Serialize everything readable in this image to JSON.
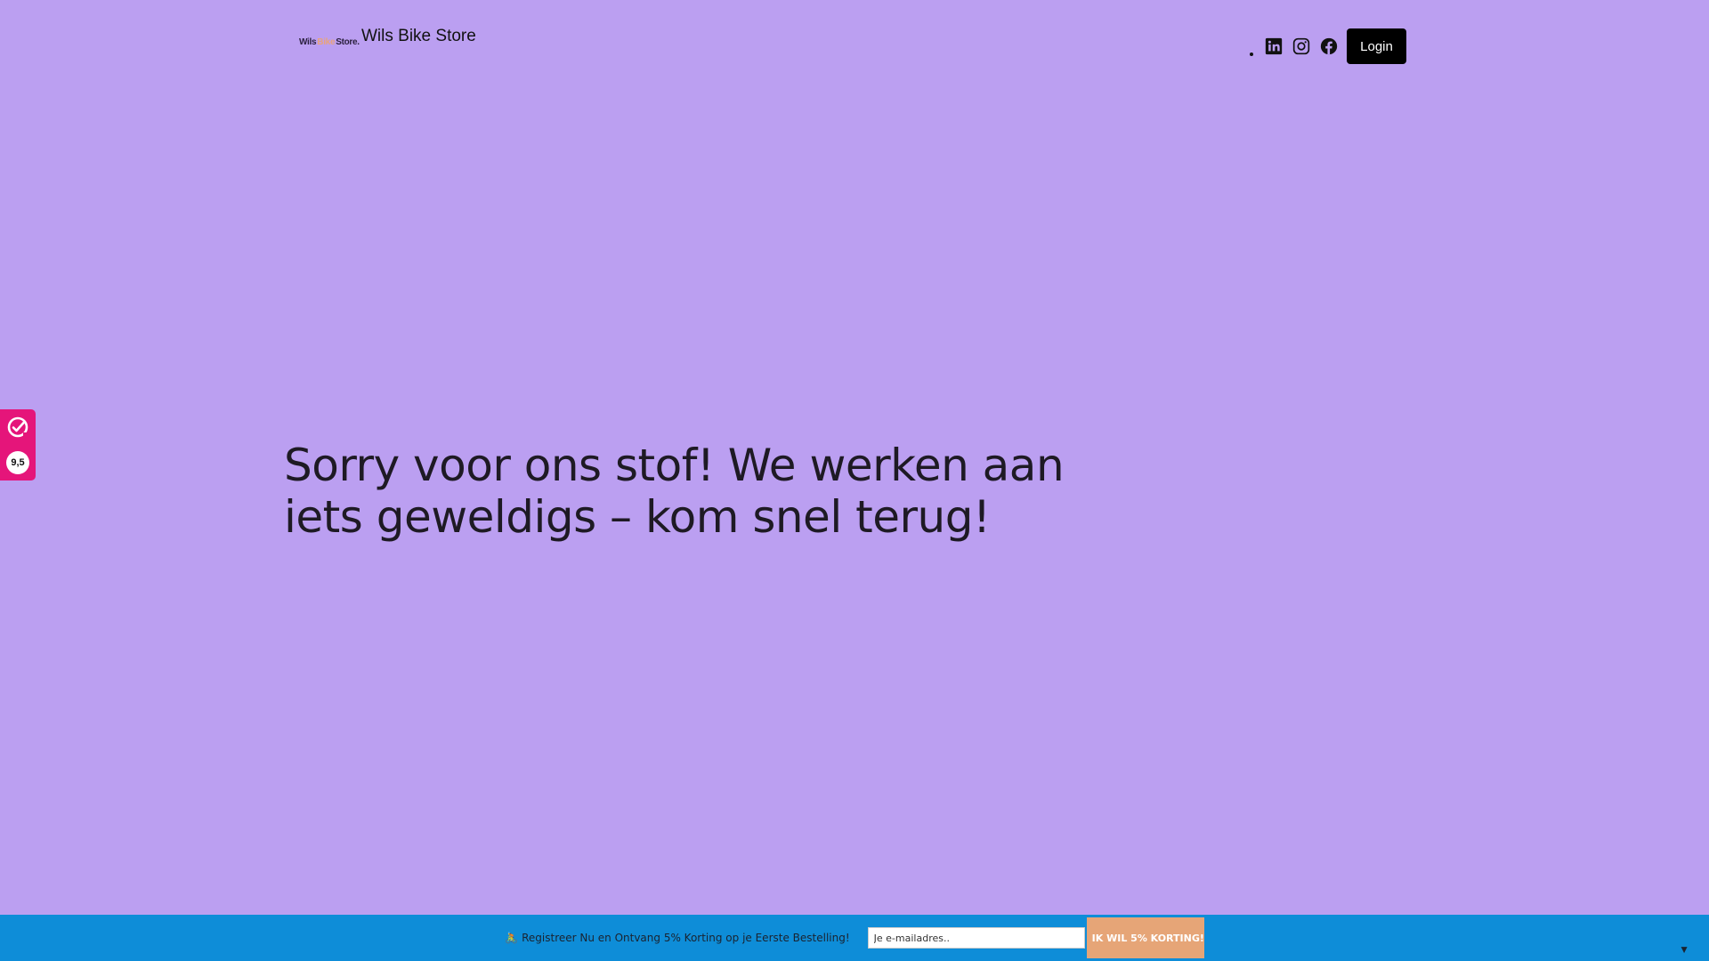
{
  "header": {
    "logo": {
      "part1": "Wils",
      "part2": "Bike",
      "part3": "Store."
    },
    "site_title": "Wils Bike Store",
    "social_icons": [
      "linkedin-icon",
      "instagram-icon",
      "facebook-icon"
    ],
    "login_label": "Login"
  },
  "main": {
    "heading": "Sorry voor ons stof! We werken aan iets geweldigs – kom snel terug!"
  },
  "review_widget": {
    "score": "9,5",
    "icon": "review-check-icon"
  },
  "promo_bar": {
    "icon": "cyclist-emoji",
    "text": "🚴 Registreer Nu en Ontvang 5% Korting op je Eerste Bestelling!",
    "email_placeholder": "Je e-mailadres..",
    "button_label": "IK WIL 5% KORTING!",
    "collapse_glyph": "▼"
  },
  "colors": {
    "background": "#bb9ff1",
    "promo_bar": "#0e8dd8",
    "promo_button": "#e6a577",
    "review_widget": "#e5157a",
    "login_button": "#000000"
  }
}
